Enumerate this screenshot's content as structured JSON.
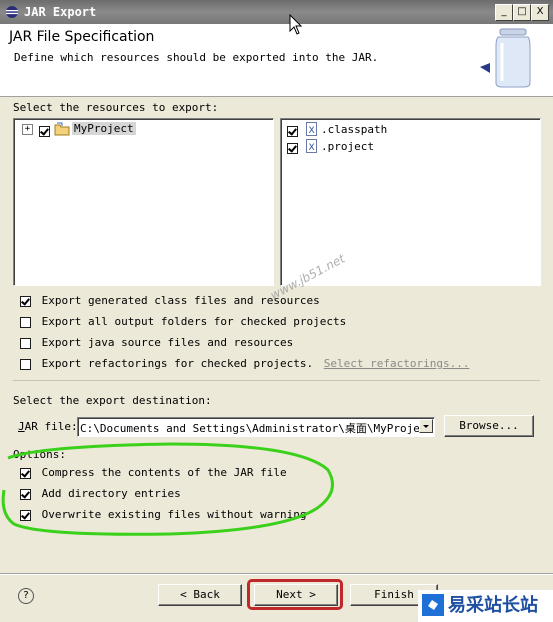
{
  "window": {
    "title": "JAR Export",
    "buttons": [
      "_",
      "□",
      "X"
    ]
  },
  "header": {
    "title": "JAR File Specification",
    "description": "Define which resources should be exported into the JAR."
  },
  "resources": {
    "label": "Select the resources to export:",
    "tree": [
      {
        "label": "MyProject",
        "checked": true,
        "expander": "+"
      }
    ],
    "files": [
      {
        "label": ".classpath",
        "checked": true
      },
      {
        "label": ".project",
        "checked": true
      }
    ]
  },
  "export_options": [
    {
      "text": "Export generated class files and resources",
      "checked": true
    },
    {
      "text": "Export all output folders for checked projects",
      "checked": false
    },
    {
      "text": "Export java source files and resources",
      "checked": false
    },
    {
      "text": "Export refactorings for checked projects.",
      "checked": false,
      "link": "Select refactorings..."
    }
  ],
  "destination": {
    "label": "Select the export destination:",
    "jar_label": "JAR file:",
    "jar_value": "C:\\Documents and Settings\\Administrator\\桌面\\MyProject.j",
    "browse_label": "Browse..."
  },
  "options": {
    "label": "Options:",
    "items": [
      {
        "text": "Compress the contents of the JAR file",
        "checked": true
      },
      {
        "text": "Add directory entries",
        "checked": true
      },
      {
        "text": "Overwrite existing files without warning",
        "checked": true
      }
    ]
  },
  "footer": {
    "help": "?",
    "back": "< Back",
    "next": "Next >",
    "finish": "Finish"
  },
  "watermark": {
    "site": "www.jb51.net",
    "brand": "易采站长站"
  },
  "colors": {
    "annotation_green": "#3bd11a",
    "annotation_red": "#c0282a",
    "link_gray": "#8a8a8a"
  }
}
